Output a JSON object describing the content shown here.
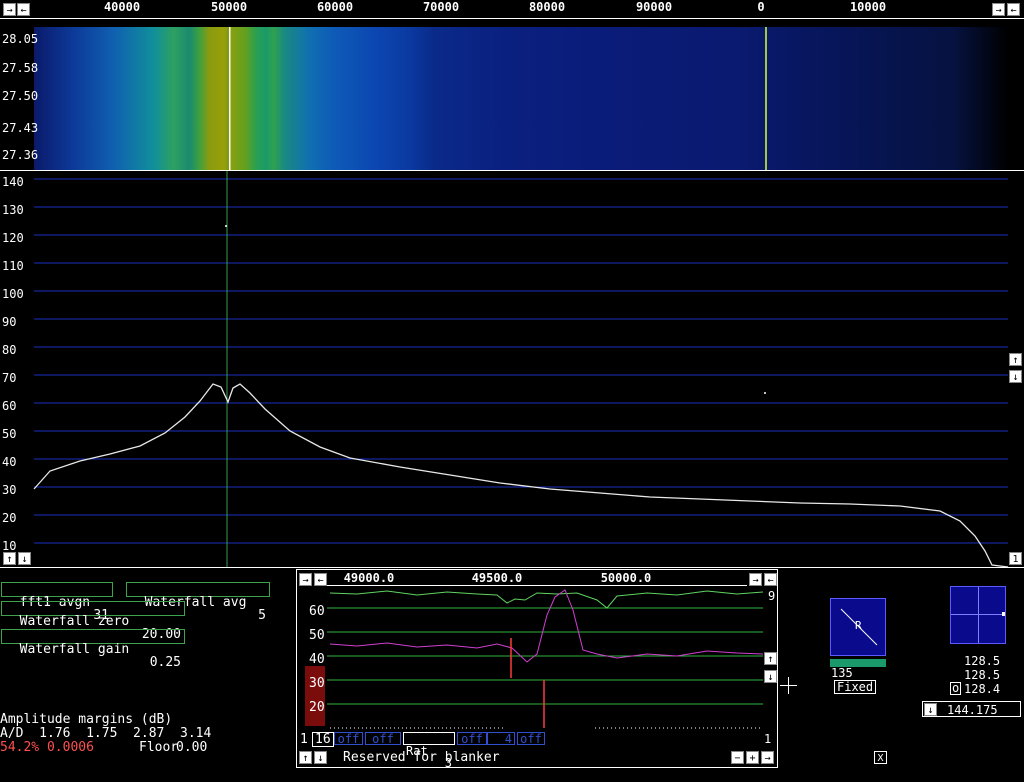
{
  "freq_axis": {
    "ticks": [
      "40000",
      "50000",
      "60000",
      "70000",
      "80000",
      "90000",
      "0",
      "10000"
    ]
  },
  "waterfall": {
    "time_labels": [
      "28.05",
      "27.58",
      "27.50",
      "27.43",
      "27.36"
    ]
  },
  "spectrum": {
    "y_labels": [
      "140",
      "130",
      "120",
      "110",
      "100",
      "90",
      "80",
      "70",
      "60",
      "50",
      "40",
      "30",
      "20",
      "10"
    ]
  },
  "params": {
    "fft1_avgn_label": "fft1 avgn",
    "fft1_avgn_value": "31",
    "waterfall_avg_label": "Waterfall avg",
    "waterfall_avg_value": "5",
    "waterfall_zero_label": "Waterfall zero",
    "waterfall_zero_value": "20.00",
    "waterfall_gain_label": "Waterfall gain",
    "waterfall_gain_value": "0.25"
  },
  "margins": {
    "title": "Amplitude margins (dB)",
    "ad_line": "A/D  1.76  1.75  2.87  3.14",
    "cpu": "54.2% 0.0006",
    "floor_label": "Floor",
    "floor_value": "0.00"
  },
  "baseband": {
    "freq_labels": [
      "49000.0",
      "49500.0",
      "50000.0"
    ],
    "y_labels": [
      "60",
      "50",
      "40",
      "30",
      "20"
    ],
    "right_number": "9",
    "bottom_num_left": "1",
    "bottom_num_16": "16",
    "tab_off1": "off",
    "tab_off2": "off",
    "rat_label": "Rat",
    "rat_value": "3",
    "tab_off3": "off",
    "tab_4": "4",
    "tab_off4": "off",
    "bottom_num_right": "1",
    "status": "Reserved for blanker"
  },
  "smeter": {
    "value": "135",
    "fixed_label": "Fixed",
    "r_label": "R"
  },
  "afc": {
    "v1": "128.5",
    "v2": "128.5",
    "v3": "128.4",
    "o_label": "o",
    "freq": "144.175"
  },
  "close_label": "X",
  "colors": {
    "grid_blue": "#1a2fbf",
    "trace": "#ffffff",
    "marker": "#a0c840",
    "green_box": "#3fa34d"
  }
}
